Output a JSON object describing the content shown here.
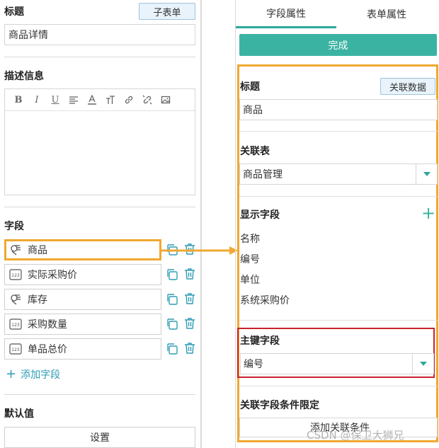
{
  "left": {
    "title_section": {
      "label": "标题",
      "subform_button": "子表单",
      "title_value": "商品详情"
    },
    "description": {
      "label": "描述信息",
      "editor_value": ""
    },
    "fields_section": {
      "label": "字段",
      "items": [
        {
          "label": "商品",
          "icon": "relation-icon"
        },
        {
          "label": "实际采购价",
          "icon": "number-icon"
        },
        {
          "label": "库存",
          "icon": "relation-icon"
        },
        {
          "label": "采购数量",
          "icon": "number-icon"
        },
        {
          "label": "单品总价",
          "icon": "number-icon"
        }
      ],
      "add_label": "添加字段"
    },
    "default_section": {
      "label": "默认值",
      "setup_button": "设置"
    }
  },
  "right": {
    "tabs": [
      "字段属性",
      "表单属性"
    ],
    "done_button": "完成",
    "title_section": {
      "label": "标题",
      "link_button": "关联数据",
      "value": "商品"
    },
    "related_table": {
      "label": "关联表",
      "value": "商品管理"
    },
    "display_fields": {
      "label": "显示字段",
      "items": [
        "名称",
        "编号",
        "单位",
        "系统采购价"
      ]
    },
    "primary_key": {
      "label": "主键字段",
      "value": "编号"
    },
    "condition": {
      "label": "关联字段条件限定",
      "add_label": "添加关联条件"
    }
  },
  "watermark": "CSDN @保卫大狮兄",
  "colors": {
    "accent": "#3bb3a3",
    "highlight_orange": "#f0a830",
    "highlight_red": "#c8232c",
    "link": "#2e9cb6"
  }
}
